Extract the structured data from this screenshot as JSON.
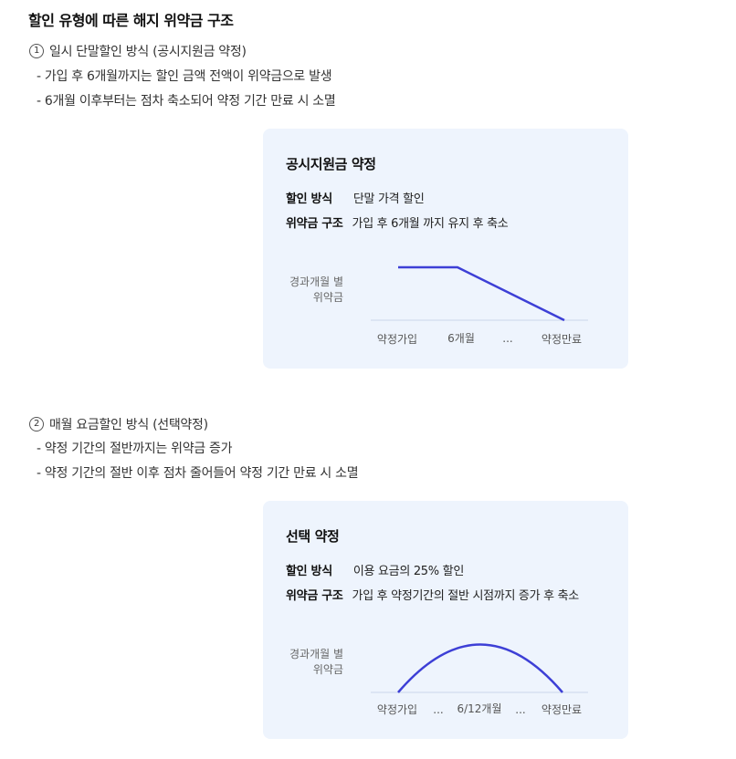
{
  "title": "할인 유형에 따른 해지 위약금 구조",
  "sections": [
    {
      "num": "1",
      "heading": "일시 단말할인 방식 (공시지원금 약정)",
      "bullets": [
        "- 가입 후 6개월까지는 할인 금액 전액이 위약금으로 발생",
        "- 6개월 이후부터는 점차 축소되어 약정 기간 만료 시 소멸"
      ],
      "card": {
        "title": "공시지원금 약정",
        "method_key": "할인 방식",
        "method_val": "단말 가격 할인",
        "penalty_key": "위약금 구조",
        "penalty_val": "가입 후 6개월 까지 유지 후 축소",
        "ylabel": "경과개월 별\n위약금",
        "xlabels": [
          "약정가입",
          "6개월",
          "...",
          "약정만료"
        ]
      }
    },
    {
      "num": "2",
      "heading": "매월 요금할인 방식 (선택약정)",
      "bullets": [
        "- 약정 기간의 절반까지는 위약금 증가",
        "- 약정 기간의 절반 이후 점차 줄어들어 약정 기간 만료 시 소멸"
      ],
      "card": {
        "title": "선택 약정",
        "method_key": "할인 방식",
        "method_val": "이용 요금의 25% 할인",
        "penalty_key": "위약금 구조",
        "penalty_val": "가입 후 약정기간의 절반 시점까지 증가 후 축소",
        "ylabel": "경과개월 별\n위약금",
        "xlabels": [
          "약정가입",
          "...",
          "6/12개월",
          "...",
          "약정만료"
        ]
      }
    }
  ],
  "colors": {
    "line": "#3d3fd6",
    "card_bg": "#eef4fd",
    "axis": "#c9d6ea"
  }
}
